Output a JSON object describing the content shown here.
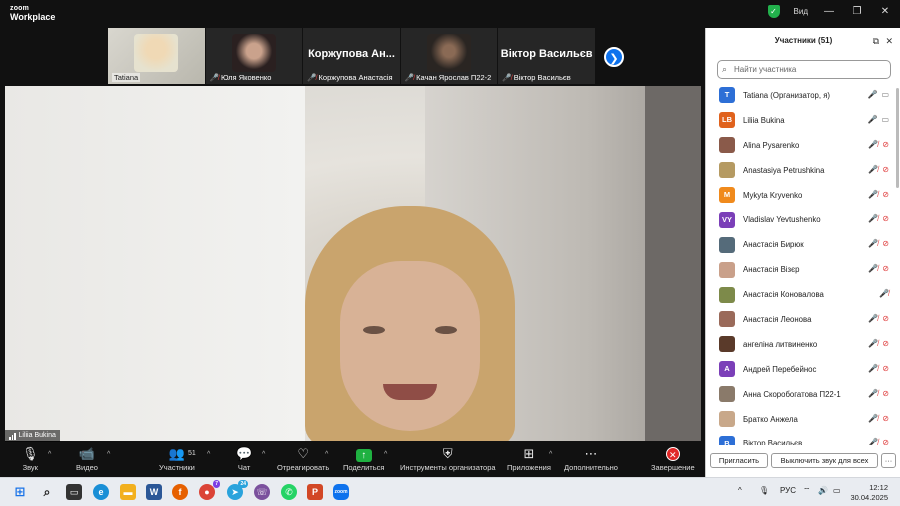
{
  "app": {
    "logo_line1": "zoom",
    "logo_line2": "Workplace",
    "view_label": "Вид"
  },
  "colors": {
    "accent": "#0e72ed",
    "muted": "#e04040",
    "share": "#1fb141",
    "end": "#e02828",
    "secure": "#22b14c"
  },
  "thumbnails": [
    {
      "name": "Tatiana",
      "muted": false,
      "active": true
    },
    {
      "name": "Юля Яковенко",
      "muted": true
    },
    {
      "name": "Коржупова Анастасія",
      "big_name": "Коржупова  Ан...",
      "muted": true
    },
    {
      "name": "Качан Ярослав П22-2",
      "muted": true
    },
    {
      "name": "Віктор Васильєв",
      "big_name": "Віктор Васильєв",
      "muted": true
    }
  ],
  "main_video": {
    "speaker": "Liliia Bukina"
  },
  "toolbar": {
    "mute": "Звук",
    "video": "Видео",
    "participants": "Участники",
    "participants_count": "51",
    "chat": "Чат",
    "react": "Отреагировать",
    "share": "Поделиться",
    "host_tools": "Инструменты организатора",
    "apps": "Приложения",
    "more": "Дополнительно",
    "end": "Завершение"
  },
  "panel": {
    "title": "Участники (51)",
    "search_placeholder": "Найти участника",
    "participants": [
      {
        "name": "Tatiana (Организатор, я)",
        "initials": "T",
        "color": "#2d6fd6",
        "mic": "on",
        "cam": "on"
      },
      {
        "name": "Liliia Bukina",
        "initials": "LB",
        "color": "#e0621d",
        "mic": "on",
        "cam": "on"
      },
      {
        "name": "Alina Pysarenko",
        "initials": "",
        "color": "#8a5a4a",
        "mic": "off",
        "cam": "off"
      },
      {
        "name": "Anastasiya Petrushkina",
        "initials": "",
        "color": "#b59a62",
        "mic": "off",
        "cam": "off"
      },
      {
        "name": "Mykyta Kryvenko",
        "initials": "M",
        "color": "#f08a1c",
        "mic": "off",
        "cam": "off"
      },
      {
        "name": "Vladislav Yevtushenko",
        "initials": "VY",
        "color": "#7b3fb8",
        "mic": "off",
        "cam": "off"
      },
      {
        "name": "Анастасія Бирюк",
        "initials": "",
        "color": "#556b7a",
        "mic": "off",
        "cam": "off"
      },
      {
        "name": "Анастасія Візєр",
        "initials": "",
        "color": "#c9a08a",
        "mic": "off",
        "cam": "off"
      },
      {
        "name": "Анастасія Коновалова",
        "initials": "",
        "color": "#7d8a4a",
        "mic": "off",
        "cam": "none"
      },
      {
        "name": "Анастасія Леонова",
        "initials": "",
        "color": "#9a6a5a",
        "mic": "off",
        "cam": "off"
      },
      {
        "name": "ангеліна литвиненко",
        "initials": "",
        "color": "#5a3a2a",
        "mic": "off",
        "cam": "off"
      },
      {
        "name": "Андрей Перебейнос",
        "initials": "A",
        "color": "#7b3fb8",
        "mic": "off",
        "cam": "off"
      },
      {
        "name": "Анна Скоробогатова П22-1",
        "initials": "",
        "color": "#8a7a6a",
        "mic": "off",
        "cam": "off"
      },
      {
        "name": "Братко Анжела",
        "initials": "",
        "color": "#c8a88a",
        "mic": "off",
        "cam": "off"
      },
      {
        "name": "Віктор Васильєв",
        "initials": "B",
        "color": "#2d6fd6",
        "mic": "off",
        "cam": "off"
      }
    ],
    "invite": "Пригласить",
    "mute_all": "Выключить звук для всех",
    "more": "···"
  },
  "taskbar": {
    "lang": "РУС",
    "time": "12:12",
    "date": "30.04.2025",
    "chrome_badge": "7",
    "telegram_badge": "24"
  }
}
